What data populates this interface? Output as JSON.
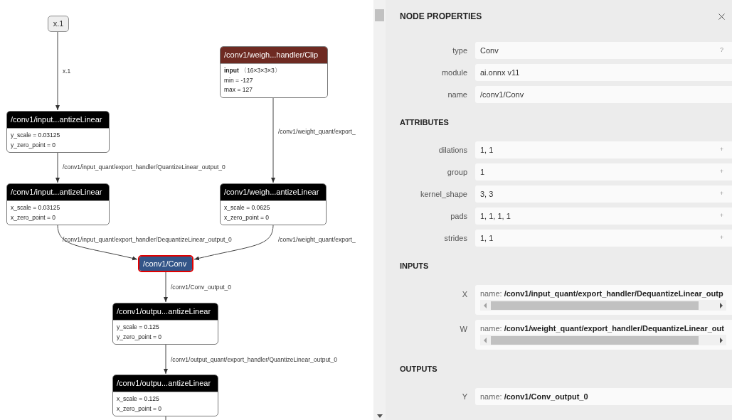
{
  "graph": {
    "nodes": [
      {
        "kind": "input",
        "title": "x.1",
        "selected": false
      },
      {
        "kind": "operator",
        "title": "/conv1/weigh...handler/Clip",
        "color": "#6e2a22",
        "selected": false,
        "lines": [
          "**input** 〈16×3×3×3〉",
          "min = -127",
          "max = 127"
        ]
      },
      {
        "kind": "operator",
        "title": "/conv1/input...antizeLinear",
        "color": "#000000",
        "selected": false,
        "lines": [
          "y_scale = 0.03125",
          "y_zero_point = 0"
        ]
      },
      {
        "kind": "operator",
        "title": "/conv1/input...antizeLinear",
        "color": "#000000",
        "selected": false,
        "lines": [
          "x_scale = 0.03125",
          "x_zero_point = 0"
        ]
      },
      {
        "kind": "operator",
        "title": "/conv1/weigh...antizeLinear",
        "color": "#000000",
        "selected": false,
        "lines": [
          "x_scale = 0.0625",
          "x_zero_point = 0"
        ]
      },
      {
        "kind": "operator",
        "title": "/conv1/Conv",
        "color": "#335588",
        "selected": true
      },
      {
        "kind": "operator",
        "title": "/conv1/outpu...antizeLinear",
        "color": "#000000",
        "selected": false,
        "lines": [
          "y_scale = 0.125",
          "y_zero_point = 0"
        ]
      },
      {
        "kind": "operator",
        "title": "/conv1/outpu...antizeLinear",
        "color": "#000000",
        "selected": false,
        "lines": [
          "x_scale = 0.125",
          "x_zero_point = 0"
        ]
      }
    ],
    "edges": [
      {
        "label": "x.1"
      },
      {
        "label": "/conv1/input_quant/export_handler/QuantizeLinear_output_0"
      },
      {
        "label": "/conv1/weight_quant/export_"
      },
      {
        "label": "/conv1/input_quant/export_handler/DequantizeLinear_output_0"
      },
      {
        "label": "/conv1/weight_quant/export_"
      },
      {
        "label": "/conv1/Conv_output_0"
      },
      {
        "label": "/conv1/output_quant/export_handler/QuantizeLinear_output_0"
      }
    ]
  },
  "panel": {
    "title": "NODE PROPERTIES",
    "node_rows": [
      {
        "label": "type",
        "value": "Conv",
        "action": "?"
      },
      {
        "label": "module",
        "value": "ai.onnx v11"
      },
      {
        "label": "name",
        "value": "/conv1/Conv"
      }
    ],
    "sections": [
      {
        "title": "ATTRIBUTES",
        "rows": [
          {
            "kind": "value",
            "label": "dilations",
            "value": "1, 1",
            "action": "+"
          },
          {
            "kind": "value",
            "label": "group",
            "value": "1",
            "action": "+"
          },
          {
            "kind": "value",
            "label": "kernel_shape",
            "value": "3, 3",
            "action": "+"
          },
          {
            "kind": "value",
            "label": "pads",
            "value": "1, 1, 1, 1",
            "action": "+"
          },
          {
            "kind": "value",
            "label": "strides",
            "value": "1, 1",
            "action": "+"
          }
        ]
      },
      {
        "title": "INPUTS",
        "rows": [
          {
            "kind": "scrollable",
            "label": "X",
            "prefix": "name:",
            "value": "/conv1/input_quant/export_handler/DequantizeLinear_outp"
          },
          {
            "kind": "scrollable",
            "label": "W",
            "prefix": "name:",
            "value": "/conv1/weight_quant/export_handler/DequantizeLinear_out"
          }
        ]
      },
      {
        "title": "OUTPUTS",
        "rows": [
          {
            "kind": "named",
            "label": "Y",
            "prefix": "name:",
            "value": "/conv1/Conv_output_0"
          }
        ]
      }
    ]
  }
}
